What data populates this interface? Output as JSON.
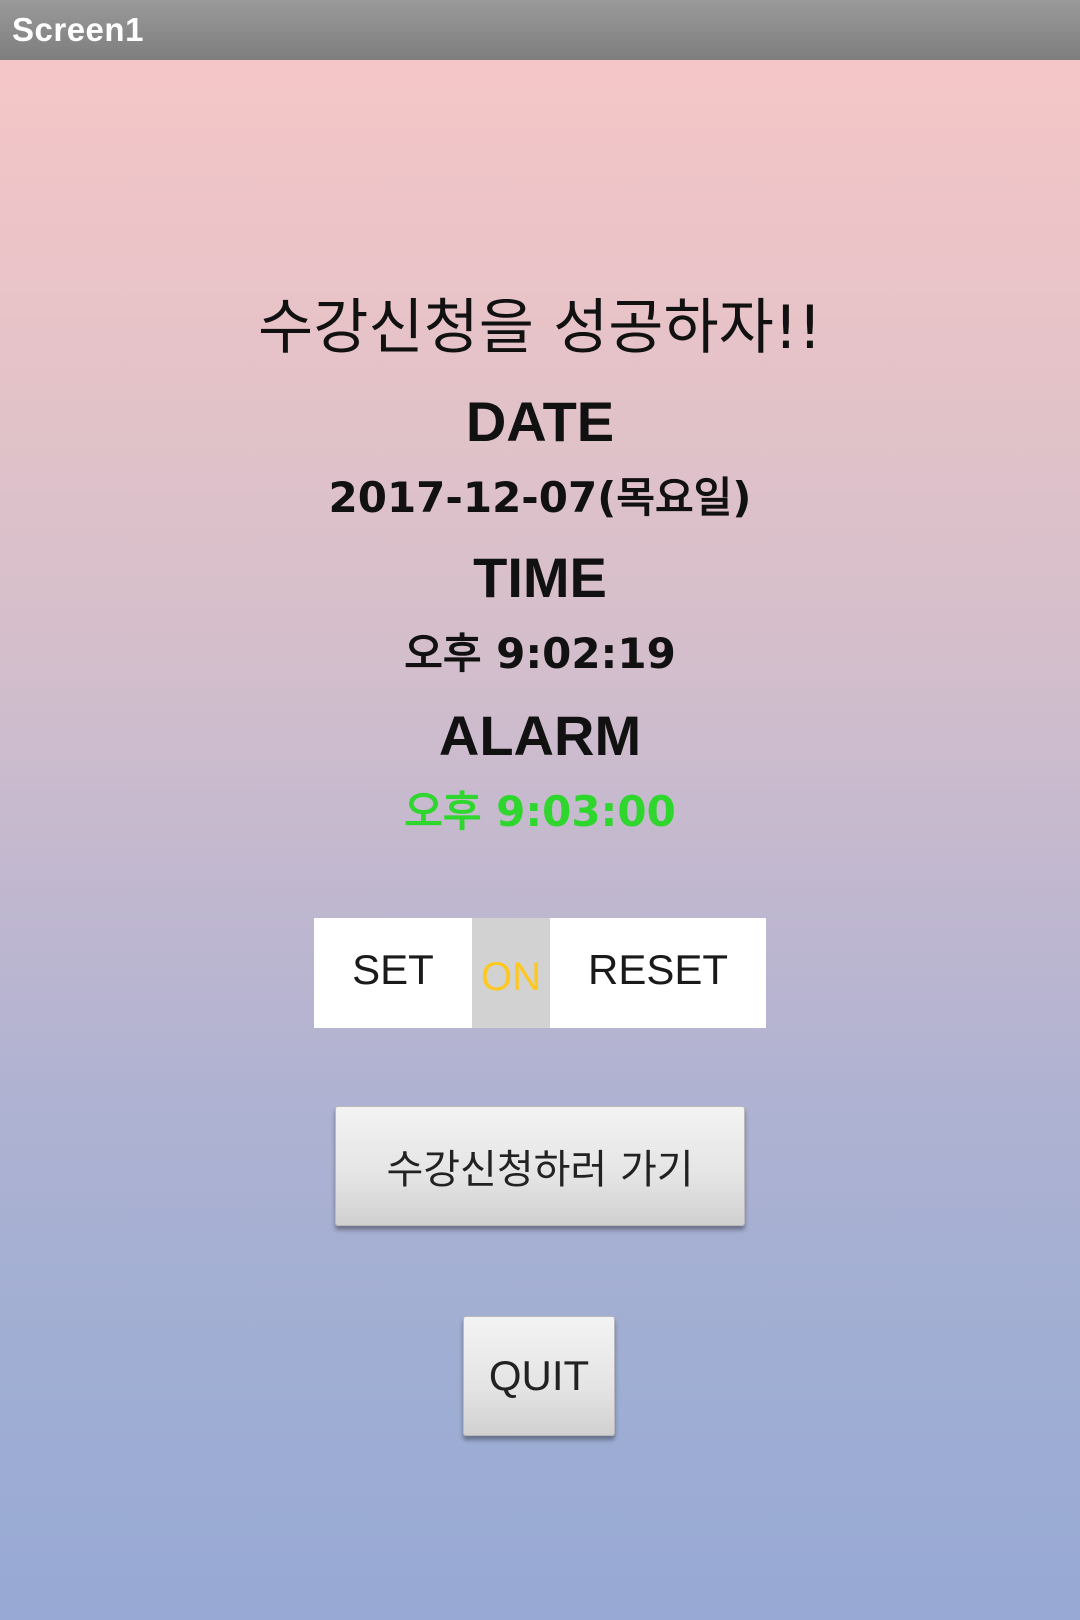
{
  "window": {
    "title": "Screen1"
  },
  "main": {
    "heading": "수강신청을 성공하자!!",
    "date_label": "DATE",
    "date_value": "2017-12-07(목요일)",
    "time_label": "TIME",
    "time_value": "오후 9:02:19",
    "alarm_label": "ALARM",
    "alarm_value": "오후 9:03:00"
  },
  "alarm_controls": {
    "set_label": "SET",
    "status_label": "ON",
    "reset_label": "RESET"
  },
  "actions": {
    "register_label": "수강신청하러 가기",
    "quit_label": "QUIT"
  },
  "colors": {
    "alarm_value": "#2ed62e",
    "status_on": "#ffc81f",
    "title_bar": "#8c8c8c",
    "gradient_top": "#f5c6c7",
    "gradient_bottom": "#97a9d4"
  }
}
